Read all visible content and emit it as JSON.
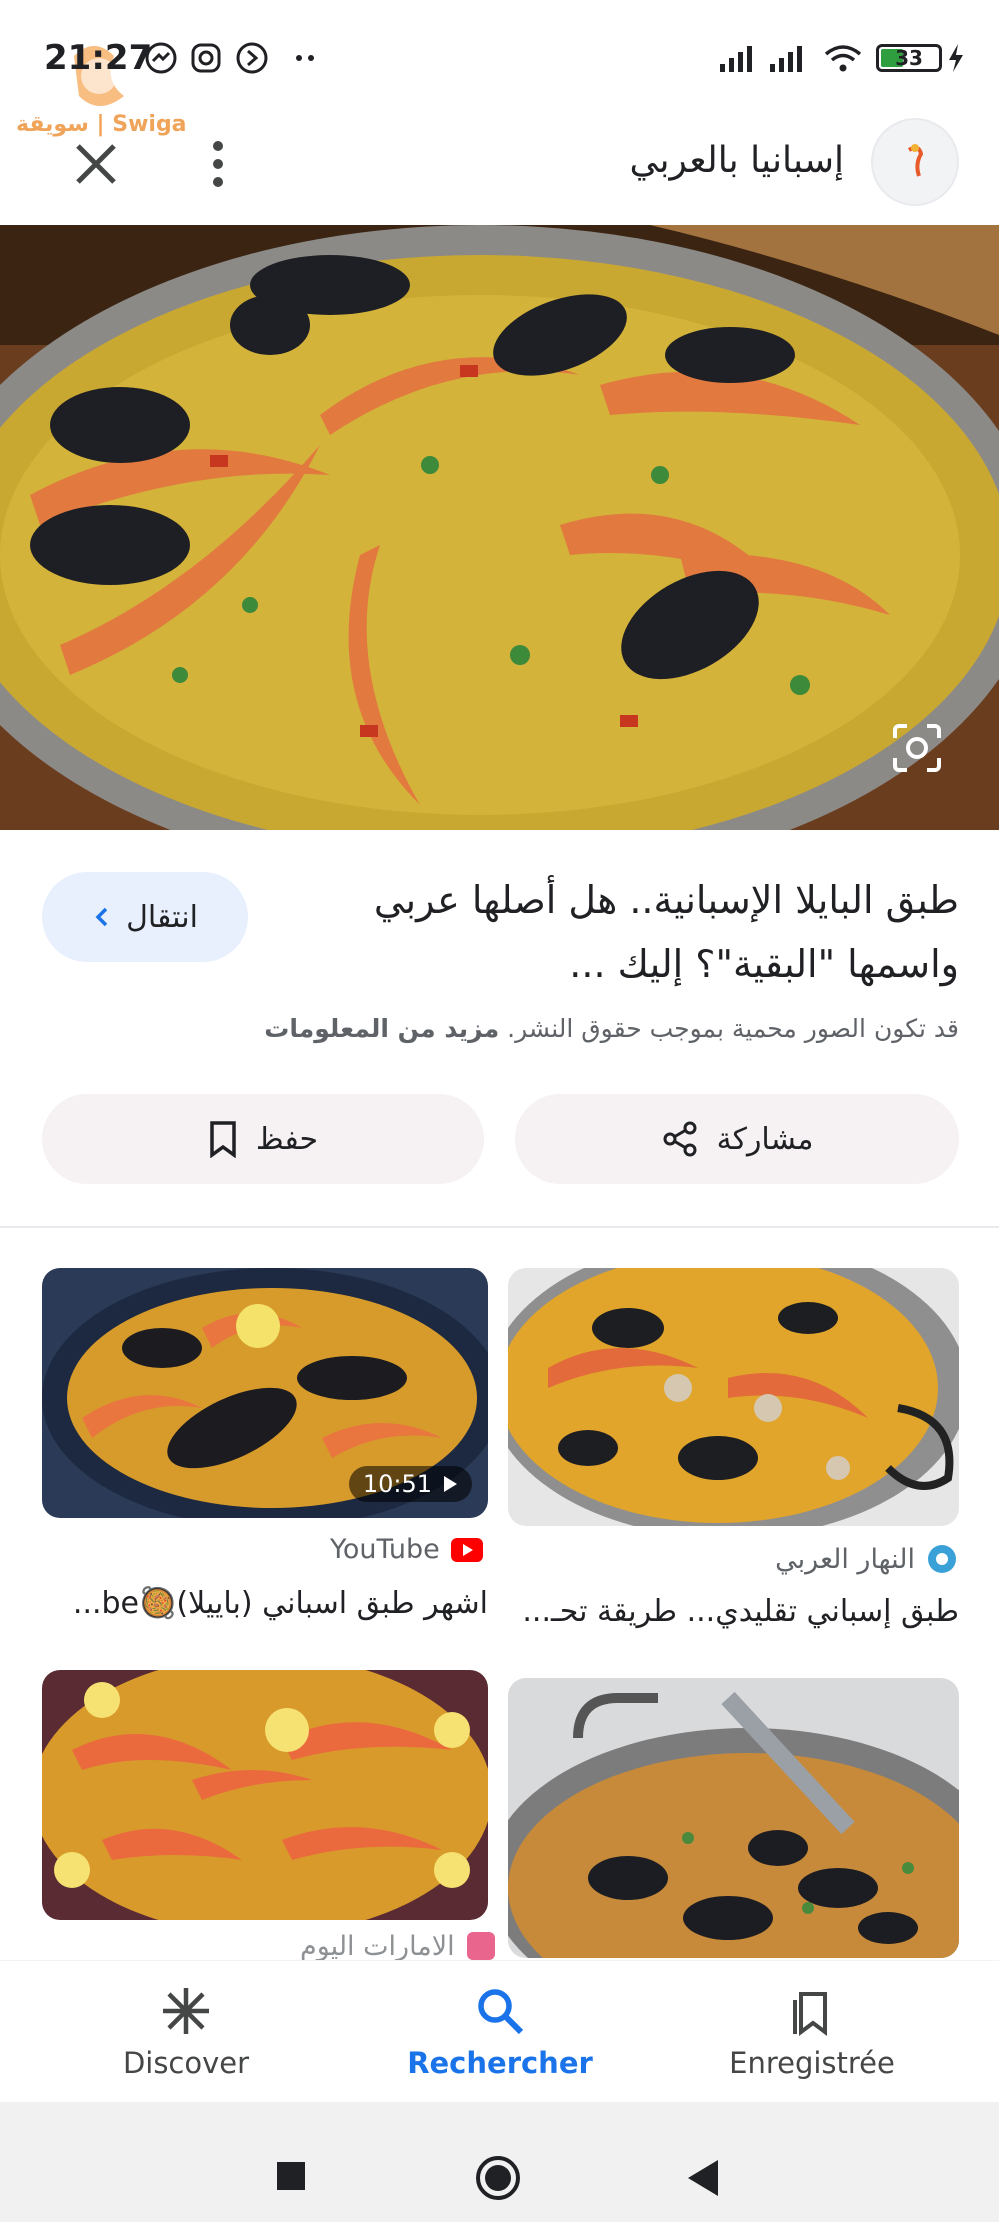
{
  "status_bar": {
    "time": "21:27",
    "battery": "33",
    "watermark": "سويقة | Swiga"
  },
  "header": {
    "site_name": "إسبانيا بالعربي",
    "close_icon": "close-icon",
    "menu_icon": "more-vert-icon"
  },
  "result": {
    "title": "طبق البايلا الإسبانية.. هل أصلها عربي واسمها \"البقية\"؟ إليك ...",
    "go_button": "انتقال",
    "copyright_text": "قد تكون الصور محمية بموجب حقوق النشر.",
    "more_info": "مزيد من المعلومات",
    "share_label": "مشاركة",
    "save_label": "حفظ"
  },
  "related": [
    {
      "source": "النهار العربي",
      "caption": "طبق إسباني تقليدي... طريقة تحـ..."
    },
    {
      "source": "YouTube",
      "caption": "اشهر طبق اسباني (باييلا)🥘be...",
      "duration": "10:51"
    },
    {
      "source": "",
      "caption": ""
    },
    {
      "source": "الامارات اليوم",
      "caption": ""
    }
  ],
  "bottom_nav": {
    "items": [
      {
        "label": "Discover",
        "icon": "asterisk-icon"
      },
      {
        "label": "Rechercher",
        "icon": "search-icon"
      },
      {
        "label": "Enregistrée",
        "icon": "bookmarks-icon"
      }
    ]
  },
  "colors": {
    "accent": "#1a73e8",
    "go_button_bg": "#e8f0fe",
    "pill_bg": "#f6f1f3"
  }
}
